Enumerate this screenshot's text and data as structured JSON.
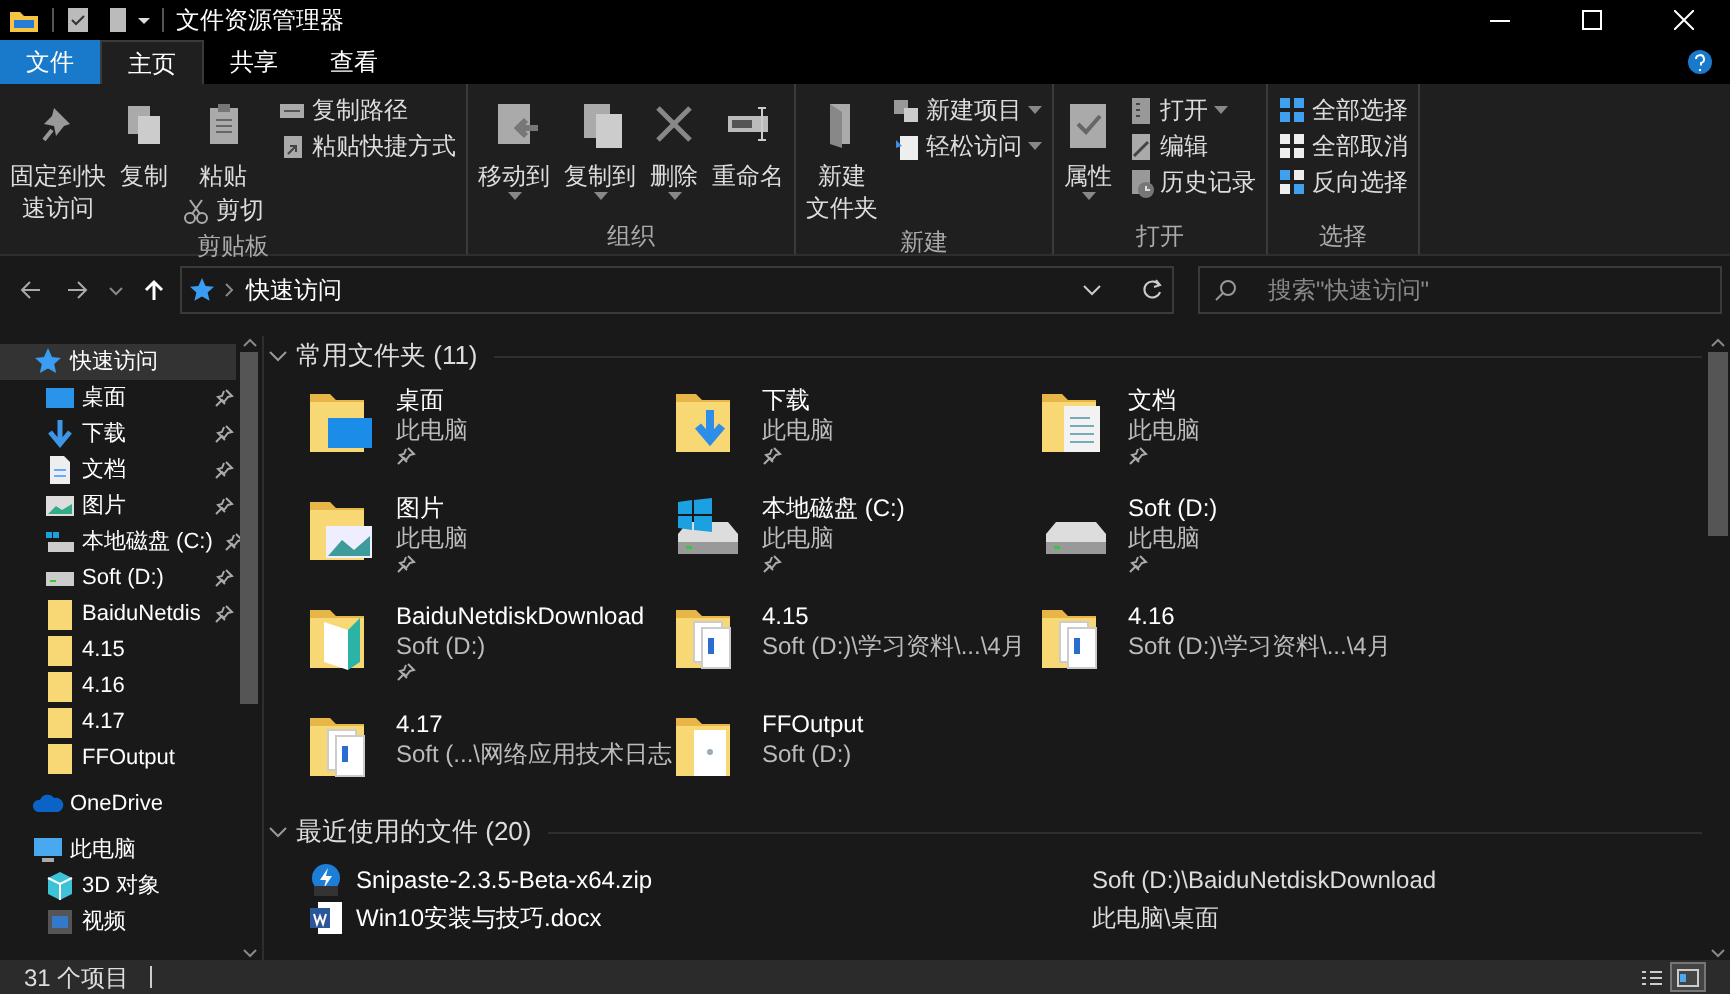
{
  "window": {
    "title": "文件资源管理器"
  },
  "tabs": [
    {
      "label": "文件",
      "selected": false,
      "kind": "file"
    },
    {
      "label": "主页",
      "selected": true,
      "kind": "tab"
    },
    {
      "label": "共享",
      "selected": false,
      "kind": "tab"
    },
    {
      "label": "查看",
      "selected": false,
      "kind": "tab"
    }
  ],
  "ribbon": {
    "groups": [
      {
        "label": "剪贴板",
        "columns": [
          [
            {
              "lines": [
                "固定到快",
                "速访问"
              ],
              "kind": "pin",
              "large": true,
              "dropdown": false
            }
          ],
          [
            {
              "label": "复制",
              "kind": "copy",
              "large": true,
              "dropdown": false
            }
          ],
          [
            {
              "label": "粘贴",
              "kind": "paste",
              "large": true,
              "dropdown": false
            },
            {
              "label": "剪切",
              "kind": "cut",
              "large": false,
              "dropdown": false
            }
          ],
          [
            {
              "label": "复制路径",
              "kind": "copypath",
              "large": false,
              "dropdown": false
            },
            {
              "label": "粘贴快捷方式",
              "kind": "pasteshortcut",
              "large": false,
              "dropdown": false
            }
          ]
        ]
      },
      {
        "label": "组织",
        "columns": [
          [
            {
              "label": "移动到",
              "kind": "moveto",
              "large": true,
              "dropdown": true
            }
          ],
          [
            {
              "label": "复制到",
              "kind": "copyto",
              "large": true,
              "dropdown": true
            }
          ],
          [
            {
              "label": "删除",
              "kind": "delete",
              "large": true,
              "dropdown": true
            }
          ],
          [
            {
              "label": "重命名",
              "kind": "rename",
              "large": true,
              "dropdown": false
            }
          ]
        ]
      },
      {
        "label": "新建",
        "columns": [
          [
            {
              "lines": [
                "新建",
                "文件夹"
              ],
              "kind": "newfolder",
              "large": true,
              "dropdown": false
            }
          ],
          [
            {
              "label": "新建项目",
              "kind": "newitem",
              "large": false,
              "dropdown": true
            },
            {
              "label": "轻松访问",
              "kind": "easyaccess",
              "large": false,
              "dropdown": true
            }
          ]
        ]
      },
      {
        "label": "打开",
        "columns": [
          [
            {
              "label": "属性",
              "kind": "properties",
              "large": true,
              "dropdown": true
            }
          ],
          [
            {
              "label": "打开",
              "kind": "open",
              "large": false,
              "dropdown": true
            },
            {
              "label": "编辑",
              "kind": "edit",
              "large": false,
              "dropdown": false
            },
            {
              "label": "历史记录",
              "kind": "history",
              "large": false,
              "dropdown": false
            }
          ]
        ]
      },
      {
        "label": "选择",
        "columns": [
          [
            {
              "label": "全部选择",
              "kind": "selectall",
              "large": false,
              "dropdown": false
            },
            {
              "label": "全部取消",
              "kind": "selectnone",
              "large": false,
              "dropdown": false
            },
            {
              "label": "反向选择",
              "kind": "invert",
              "large": false,
              "dropdown": false
            }
          ]
        ]
      }
    ]
  },
  "address": {
    "path": "快速访问"
  },
  "search": {
    "placeholder": "搜索\"快速访问\""
  },
  "sidebar": {
    "items": [
      {
        "label": "快速访问",
        "kind": "star",
        "selected": true,
        "children": [
          {
            "label": "桌面",
            "kind": "desktop",
            "pinned": true,
            "selected": false
          },
          {
            "label": "下载",
            "kind": "download",
            "pinned": true,
            "selected": false
          },
          {
            "label": "文档",
            "kind": "documents",
            "pinned": true,
            "selected": false
          },
          {
            "label": "图片",
            "kind": "pictures",
            "pinned": true,
            "selected": false
          },
          {
            "label": "本地磁盘 (C:)",
            "kind": "drivec",
            "pinned": true,
            "selected": false
          },
          {
            "label": "Soft (D:)",
            "kind": "drive",
            "pinned": true,
            "selected": false
          },
          {
            "label": "BaiduNetdis",
            "kind": "folder",
            "pinned": true,
            "selected": false
          },
          {
            "label": "4.15",
            "kind": "folder",
            "pinned": false,
            "selected": false
          },
          {
            "label": "4.16",
            "kind": "folder",
            "pinned": false,
            "selected": false
          },
          {
            "label": "4.17",
            "kind": "folder",
            "pinned": false,
            "selected": false
          },
          {
            "label": "FFOutput",
            "kind": "folder",
            "pinned": false,
            "selected": false
          }
        ]
      },
      {
        "label": "OneDrive",
        "kind": "cloud",
        "selected": false
      },
      {
        "label": "此电脑",
        "kind": "pc",
        "selected": false,
        "children": [
          {
            "label": "3D 对象",
            "kind": "cube",
            "pinned": false,
            "selected": false
          },
          {
            "label": "视频",
            "kind": "video",
            "pinned": false,
            "selected": false
          }
        ]
      }
    ]
  },
  "sections": [
    {
      "title": "常用文件夹 (11)",
      "kind": "tiles",
      "expanded": true,
      "items": [
        {
          "name": "桌面",
          "location": "此电脑",
          "kind": "desktop",
          "pinned": true
        },
        {
          "name": "下载",
          "location": "此电脑",
          "kind": "download",
          "pinned": true
        },
        {
          "name": "文档",
          "location": "此电脑",
          "kind": "documents",
          "pinned": true
        },
        {
          "name": "图片",
          "location": "此电脑",
          "kind": "pictures",
          "pinned": true
        },
        {
          "name": "本地磁盘 (C:)",
          "location": "此电脑",
          "kind": "drivec",
          "pinned": true
        },
        {
          "name": "Soft (D:)",
          "location": "此电脑",
          "kind": "drive",
          "pinned": true
        },
        {
          "name": "BaiduNetdiskDownload",
          "location": "Soft (D:)",
          "kind": "folderteal",
          "pinned": true
        },
        {
          "name": "4.15",
          "location": "Soft (D:)\\学习资料\\...\\4月",
          "kind": "folderdocs",
          "pinned": false
        },
        {
          "name": "4.16",
          "location": "Soft (D:)\\学习资料\\...\\4月",
          "kind": "folderdocs",
          "pinned": false
        },
        {
          "name": "4.17",
          "location": "Soft (...\\网络应用技术日志",
          "kind": "folderdocs",
          "pinned": false
        },
        {
          "name": "FFOutput",
          "location": "Soft (D:)",
          "kind": "folderpage",
          "pinned": false
        }
      ]
    },
    {
      "title": "最近使用的文件 (20)",
      "kind": "list",
      "expanded": true,
      "items": [
        {
          "name": "Snipaste-2.3.5-Beta-x64.zip",
          "location": "Soft (D:)\\BaiduNetdiskDownload",
          "kind": "zip"
        },
        {
          "name": "Win10安装与技巧.docx",
          "location": "此电脑\\桌面",
          "kind": "docx"
        }
      ]
    }
  ],
  "status_bar": {
    "count": "31 个项目",
    "views": [
      {
        "kind": "details",
        "selected": false
      },
      {
        "kind": "tiles",
        "selected": true
      }
    ]
  }
}
